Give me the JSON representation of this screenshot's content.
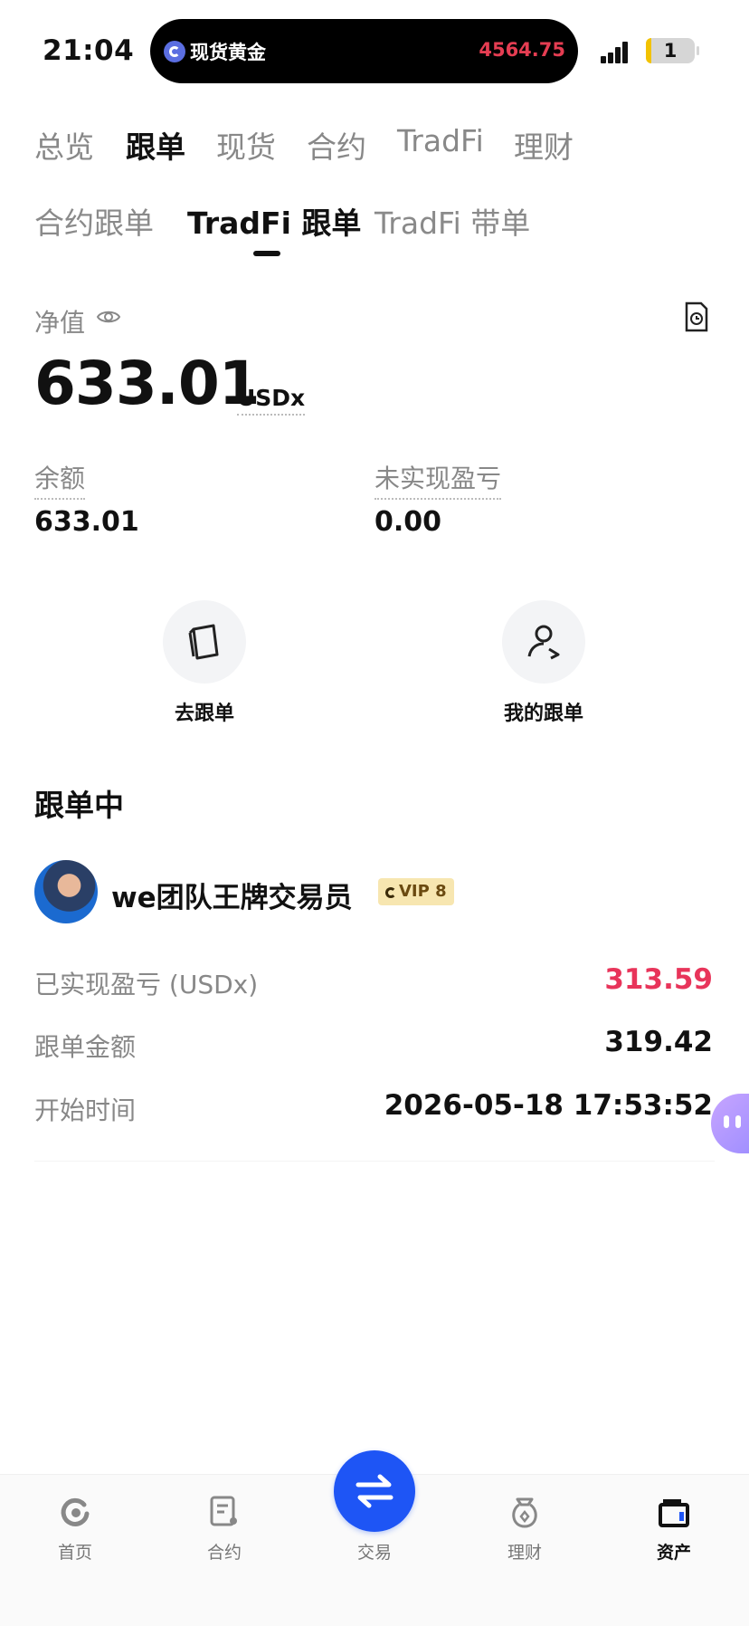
{
  "status_bar": {
    "time": "21:04",
    "island_label": "现货黄金",
    "island_price": "4564.75",
    "battery": "1"
  },
  "main_tabs": [
    {
      "label": "总览",
      "active": false
    },
    {
      "label": "跟单",
      "active": true
    },
    {
      "label": "现货",
      "active": false
    },
    {
      "label": "合约",
      "active": false
    },
    {
      "label": "TradFi",
      "active": false
    },
    {
      "label": "理财",
      "active": false
    }
  ],
  "sub_tabs": [
    {
      "label": "合约跟单",
      "active": false
    },
    {
      "label": "TradFi 跟单",
      "active": true
    },
    {
      "label": "TradFi 带单",
      "active": false
    }
  ],
  "net_value": {
    "label": "净值",
    "amount": "633.01",
    "unit": "USDx"
  },
  "balance": {
    "label": "余额",
    "value": "633.01"
  },
  "unrealized_pnl": {
    "label": "未实现盈亏",
    "value": "0.00"
  },
  "actions": [
    {
      "label": "去跟单",
      "icon": "copy-trade-icon"
    },
    {
      "label": "我的跟单",
      "icon": "user-follow-icon"
    }
  ],
  "following": {
    "title": "跟单中",
    "trader_name": "we团队王牌交易员",
    "vip": "VIP 8",
    "rows": [
      {
        "label": "已实现盈亏 (USDx)",
        "value": "313.59",
        "color": "#e8345a"
      },
      {
        "label": "跟单金额",
        "value": "319.42",
        "color": "#111111"
      },
      {
        "label": "开始时间",
        "value": "2026-05-18 17:53:52",
        "color": "#111111"
      }
    ]
  },
  "bottom_nav": [
    {
      "label": "首页",
      "icon": "home-icon",
      "active": false
    },
    {
      "label": "合约",
      "icon": "contract-icon",
      "active": false
    },
    {
      "label": "交易",
      "icon": "swap-icon",
      "active": false
    },
    {
      "label": "理财",
      "icon": "finance-icon",
      "active": false
    },
    {
      "label": "资产",
      "icon": "wallet-icon",
      "active": true
    }
  ],
  "colors": {
    "accent": "#1e55f5",
    "profit": "#e8345a",
    "island_price": "#e53d52"
  }
}
